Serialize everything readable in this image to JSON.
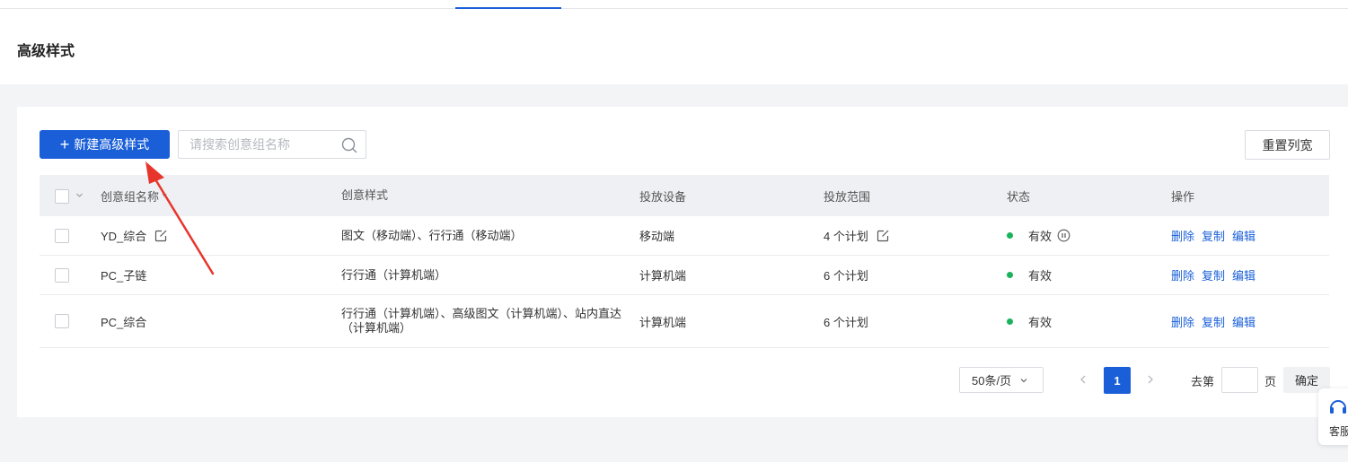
{
  "page": {
    "title": "高级样式"
  },
  "toolbar": {
    "new_button_label": "新建高级样式",
    "search_placeholder": "请搜索创意组名称",
    "reset_columns_label": "重置列宽"
  },
  "table": {
    "columns": [
      "创意组名称",
      "创意样式",
      "投放设备",
      "投放范围",
      "状态",
      "操作"
    ],
    "rows": [
      {
        "name": "YD_综合",
        "style": "图文（移动端）、行行通（移动端）",
        "device": "移动端",
        "range": "4 个计划",
        "status": "有效"
      },
      {
        "name": "PC_子链",
        "style": "行行通（计算机端）",
        "device": "计算机端",
        "range": "6 个计划",
        "status": "有效"
      },
      {
        "name": "PC_综合",
        "style": "行行通（计算机端）、高级图文（计算机端）、站内直达（计算机端）",
        "device": "计算机端",
        "range": "6 个计划",
        "status": "有效"
      }
    ],
    "actions": {
      "delete": "删除",
      "copy": "复制",
      "edit": "编辑"
    }
  },
  "pagination": {
    "page_size": "50条/页",
    "current_page": "1",
    "goto_label": "去第",
    "goto_unit": "页",
    "confirm_label": "确定"
  },
  "service_widget": {
    "label": "客服"
  },
  "colors": {
    "primary": "#1a5fd8",
    "status_active": "#18b35c",
    "annotation": "#e8352c"
  }
}
